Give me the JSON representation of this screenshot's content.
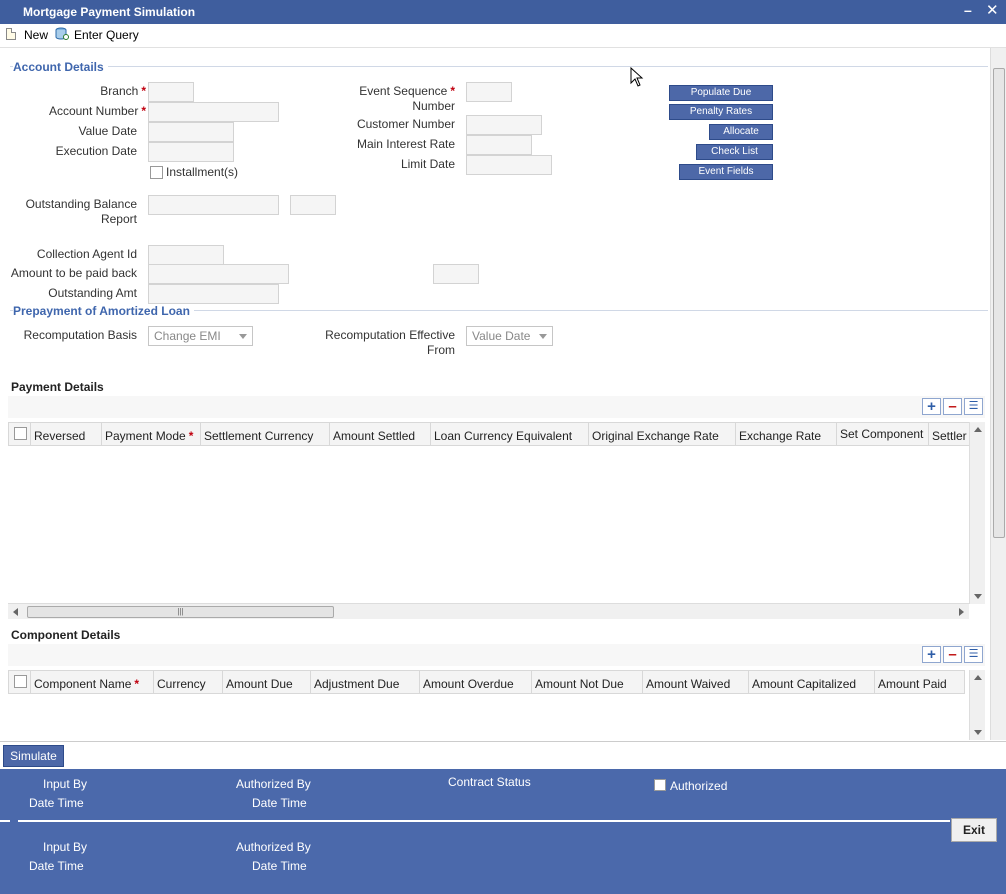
{
  "window": {
    "title": "Mortgage Payment Simulation",
    "minimize_icon": "minimize-icon",
    "close_icon": "close-icon"
  },
  "toolbar": {
    "new_label": "New",
    "enter_query_label": "Enter Query"
  },
  "account_details": {
    "section_title": "Account Details",
    "branch_label": "Branch",
    "account_number_label": "Account Number",
    "value_date_label": "Value Date",
    "execution_date_label": "Execution Date",
    "installments_label": "Installment(s)",
    "event_sequence_label_line1": "Event Sequence",
    "event_sequence_label_line2": "Number",
    "customer_number_label": "Customer Number",
    "main_interest_rate_label": "Main Interest Rate",
    "limit_date_label": "Limit Date",
    "outstanding_balance_label_line1": "Outstanding Balance",
    "outstanding_balance_label_line2": "Report",
    "collection_agent_label": "Collection Agent Id",
    "amount_paid_back_label": "Amount to be paid back",
    "outstanding_amt_label": "Outstanding Amt",
    "buttons": {
      "populate_due": "Populate Due",
      "penalty_rates": "Penalty Rates",
      "allocate": "Allocate",
      "check_list": "Check List",
      "event_fields": "Event Fields"
    }
  },
  "prepayment": {
    "section_title": "Prepayment of Amortized Loan",
    "recomputation_basis_label": "Recomputation Basis",
    "recomputation_basis_value": "Change EMI",
    "recomputation_effective_label_line1": "Recomputation Effective",
    "recomputation_effective_label_line2": "From",
    "recomputation_effective_value": "Value Date"
  },
  "payment_details": {
    "title": "Payment Details",
    "columns": [
      "Reversed",
      "Payment Mode",
      "Settlement Currency",
      "Amount Settled",
      "Loan Currency Equivalent",
      "Original Exchange Rate",
      "Exchange Rate",
      "Set Component",
      "Settler"
    ]
  },
  "component_details": {
    "title": "Component Details",
    "columns": [
      "Component Name",
      "Currency",
      "Amount Due",
      "Adjustment Due",
      "Amount Overdue",
      "Amount Not Due",
      "Amount Waived",
      "Amount Capitalized",
      "Amount Paid"
    ]
  },
  "simulate_label": "Simulate",
  "footer": {
    "input_by": "Input By",
    "date_time": "Date Time",
    "authorized_by": "Authorized By",
    "contract_status": "Contract Status",
    "authorized": "Authorized",
    "exit_label": "Exit"
  },
  "colors": {
    "title_bar": "#3f5e9e",
    "section_header": "#3f66ad",
    "button_blue": "#4d68a8",
    "footer_blue": "#4b69ab",
    "required_marker": "#c0000f"
  }
}
